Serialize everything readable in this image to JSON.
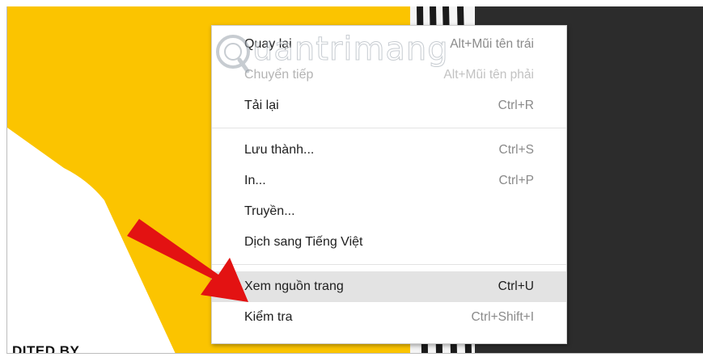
{
  "colors": {
    "yellow_panel": "#fbc400",
    "dark_panel": "#2c2c2c",
    "arrow": "#e31212",
    "menu_hover": "#e3e3e3"
  },
  "page": {
    "stray_text": "DITED BY"
  },
  "watermark": {
    "text": "uantrimang",
    "icon": "quantrimang-logo-icon"
  },
  "context_menu": {
    "groups": [
      [
        {
          "label": "Quay lại",
          "shortcut": "Alt+Mũi tên trái",
          "state": "normal"
        },
        {
          "label": "Chuyển tiếp",
          "shortcut": "Alt+Mũi tên phải",
          "state": "disabled"
        },
        {
          "label": "Tải lại",
          "shortcut": "Ctrl+R",
          "state": "normal"
        }
      ],
      [
        {
          "label": "Lưu thành...",
          "shortcut": "Ctrl+S",
          "state": "normal"
        },
        {
          "label": "In...",
          "shortcut": "Ctrl+P",
          "state": "normal"
        },
        {
          "label": "Truyền...",
          "shortcut": "",
          "state": "normal"
        },
        {
          "label": "Dịch sang Tiếng Việt",
          "shortcut": "",
          "state": "normal"
        }
      ],
      [
        {
          "label": "Xem nguồn trang",
          "shortcut": "Ctrl+U",
          "state": "hover"
        },
        {
          "label": "Kiểm tra",
          "shortcut": "Ctrl+Shift+I",
          "state": "normal"
        }
      ]
    ]
  }
}
